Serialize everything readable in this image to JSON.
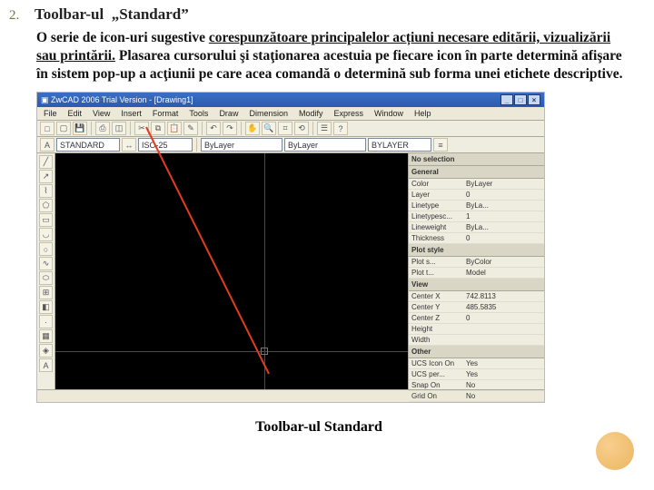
{
  "list_number": "2.",
  "heading": "Toolbar-ul  „Standard”",
  "body_plain_prefix": "O serie de icon-uri sugestive ",
  "body_underlined": "corespunzătoare principalelor acțiuni necesare editării, vizualizării sau printării.",
  "body_plain_suffix": " Plasarea cursorului şi staţionarea acestuia pe fiecare icon în parte determină afişare în sistem pop-up a acţiunii pe care acea comandă o determină sub forma unei etichete descriptive.",
  "caption": "Toolbar-ul Standard",
  "screenshot": {
    "title": "ZwCAD 2006 Trial Version - [Drawing1]",
    "winbuttons": [
      "_",
      "□",
      "×"
    ],
    "menus": [
      "File",
      "Edit",
      "View",
      "Insert",
      "Format",
      "Tools",
      "Draw",
      "Dimension",
      "Modify",
      "Express",
      "Window",
      "Help"
    ],
    "layer_row": {
      "layer_label": "STANDARD",
      "field1": "ISO-25",
      "combo1": "ByLayer",
      "combo2": "ByLayer",
      "combo3": "BYLAYER"
    },
    "props": {
      "header": "No selection",
      "groups": [
        {
          "name": "General",
          "rows": [
            {
              "k": "Color",
              "v": "ByLayer"
            },
            {
              "k": "Layer",
              "v": "0"
            },
            {
              "k": "Linetype",
              "v": "ByLa..."
            },
            {
              "k": "Linetypesc...",
              "v": "1"
            },
            {
              "k": "Lineweight",
              "v": "ByLa..."
            },
            {
              "k": "Thickness",
              "v": "0"
            }
          ]
        },
        {
          "name": "Plot style",
          "rows": [
            {
              "k": "Plot s...",
              "v": "ByColor"
            },
            {
              "k": "Plot t...",
              "v": "Model"
            }
          ]
        },
        {
          "name": "View",
          "rows": [
            {
              "k": "Center X",
              "v": "742.8113"
            },
            {
              "k": "Center Y",
              "v": "485.5835"
            },
            {
              "k": "Center Z",
              "v": "0"
            },
            {
              "k": "Height",
              "v": ""
            },
            {
              "k": "Width",
              "v": ""
            }
          ]
        },
        {
          "name": "Other",
          "rows": [
            {
              "k": "UCS Icon On",
              "v": "Yes"
            },
            {
              "k": "UCS per...",
              "v": "Yes"
            },
            {
              "k": "Snap On",
              "v": "No"
            },
            {
              "k": "Grid On",
              "v": "No"
            }
          ]
        }
      ]
    }
  }
}
